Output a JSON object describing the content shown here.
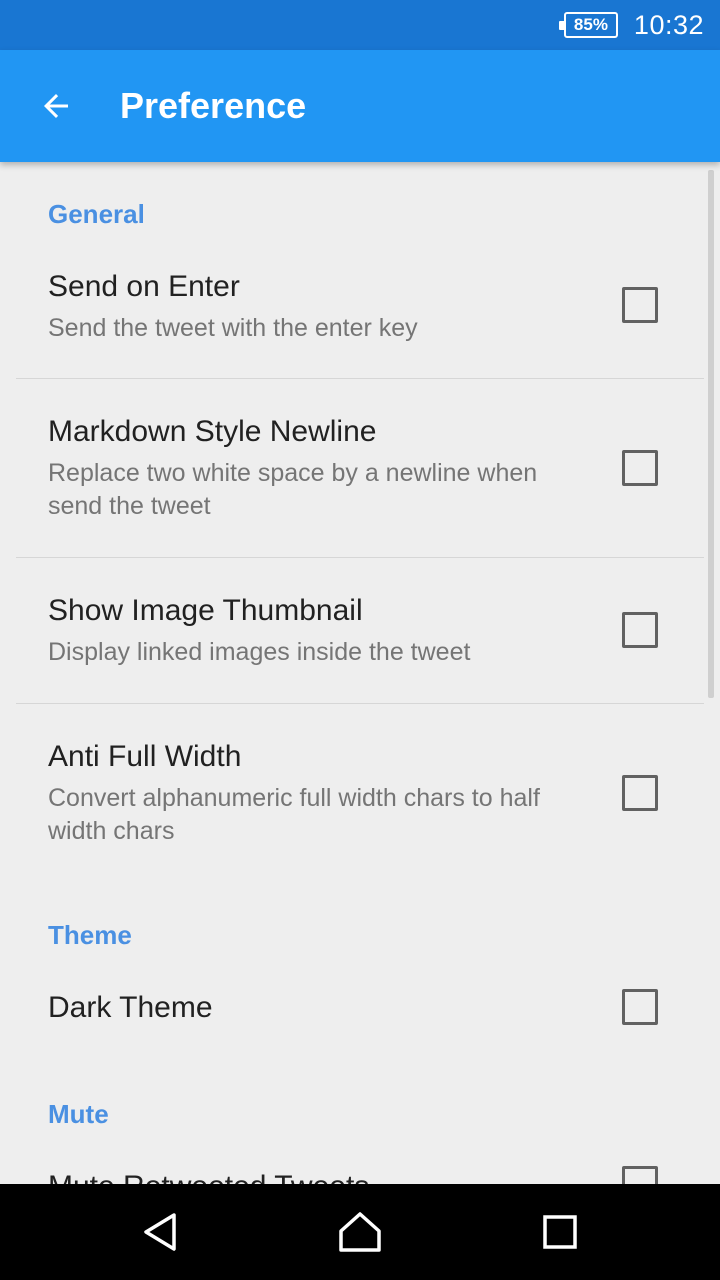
{
  "status_bar": {
    "battery": "85%",
    "time": "10:32"
  },
  "app_bar": {
    "title": "Preference"
  },
  "sections": [
    {
      "title": "General"
    },
    {
      "title": "Theme"
    },
    {
      "title": "Mute"
    }
  ],
  "preferences": [
    {
      "title": "Send on Enter",
      "summary": "Send the tweet with the enter key",
      "checked": false
    },
    {
      "title": "Markdown Style Newline",
      "summary": "Replace two white space by a newline when send the tweet",
      "checked": false
    },
    {
      "title": "Show Image Thumbnail",
      "summary": "Display linked images inside the tweet",
      "checked": false
    },
    {
      "title": "Anti Full Width",
      "summary": "Convert alphanumeric full width chars to half width chars",
      "checked": false
    },
    {
      "title": "Dark Theme",
      "checked": false
    },
    {
      "title": "Mute Retweeted Tweets",
      "checked": false
    }
  ],
  "colors": {
    "status_bar": "#1976d2",
    "app_bar": "#2196f3",
    "category": "#4a90e2",
    "background": "#eeeeee"
  },
  "icons": {
    "back": "arrow-left-icon",
    "nav_back": "triangle-back-icon",
    "nav_home": "home-icon",
    "nav_recents": "square-recents-icon"
  }
}
